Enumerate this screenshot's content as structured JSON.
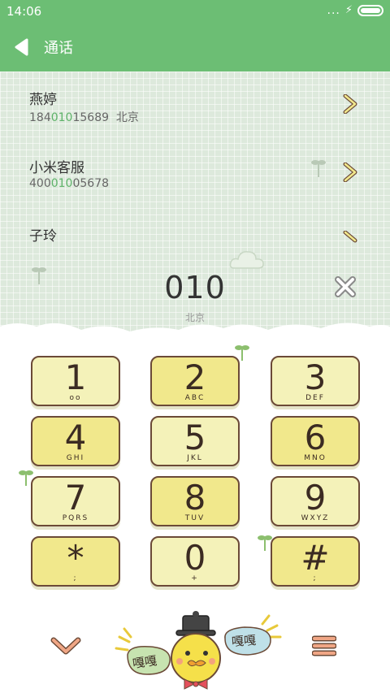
{
  "status_bar": {
    "time": "14:06",
    "signal": "...",
    "charging": "⚡"
  },
  "header": {
    "title": "通话",
    "back_icon": "back-arrow-icon"
  },
  "results": [
    {
      "name": "燕婷",
      "number_pre": "184",
      "number_match": "010",
      "number_post": "15689",
      "location": "北京"
    },
    {
      "name": "小米客服",
      "number_pre": "400",
      "number_match": "010",
      "number_post": "05678",
      "location": ""
    },
    {
      "name": "子玲",
      "number_pre": "",
      "number_match": "",
      "number_post": "",
      "location": ""
    }
  ],
  "dialer": {
    "input": "010",
    "location": "北京"
  },
  "keypad": [
    {
      "digit": "1",
      "letters": "oo"
    },
    {
      "digit": "2",
      "letters": "ABC"
    },
    {
      "digit": "3",
      "letters": "DEF"
    },
    {
      "digit": "4",
      "letters": "GHI"
    },
    {
      "digit": "5",
      "letters": "JKL"
    },
    {
      "digit": "6",
      "letters": "MNO"
    },
    {
      "digit": "7",
      "letters": "PQRS"
    },
    {
      "digit": "8",
      "letters": "TUV"
    },
    {
      "digit": "9",
      "letters": "WXYZ"
    },
    {
      "digit": "*",
      "letters": ";"
    },
    {
      "digit": "0",
      "letters": "+"
    },
    {
      "digit": "#",
      "letters": ";"
    }
  ],
  "mascot": {
    "left_bubble": "嘎嘎",
    "right_bubble": "嘎嘎"
  },
  "colors": {
    "accent": "#6cbe74",
    "match_highlight": "#5fb36a",
    "key_light": "#f4f2b9",
    "key_dark": "#f1e88c",
    "key_border": "#6b4a37"
  }
}
